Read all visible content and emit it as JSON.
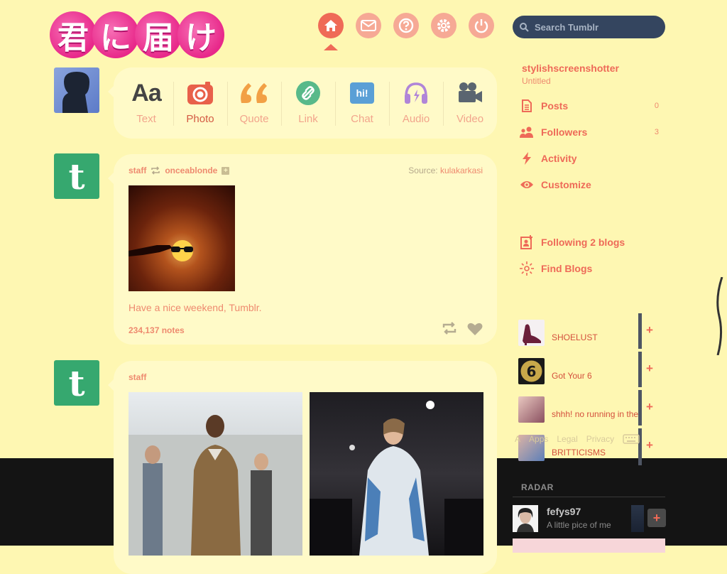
{
  "logo": {
    "chars": [
      "君",
      "に",
      "届",
      "け"
    ]
  },
  "nav": {
    "items": [
      {
        "name": "home",
        "active": true
      },
      {
        "name": "inbox"
      },
      {
        "name": "help"
      },
      {
        "name": "settings"
      },
      {
        "name": "logout"
      }
    ]
  },
  "search": {
    "placeholder": "Search Tumblr"
  },
  "post_types": [
    {
      "key": "text",
      "label": "Text",
      "icon": "Aa"
    },
    {
      "key": "photo",
      "label": "Photo"
    },
    {
      "key": "quote",
      "label": "Quote"
    },
    {
      "key": "link",
      "label": "Link"
    },
    {
      "key": "chat",
      "label": "Chat",
      "icon": "hi!"
    },
    {
      "key": "audio",
      "label": "Audio"
    },
    {
      "key": "video",
      "label": "Video"
    }
  ],
  "post1": {
    "author": "staff",
    "reblogged_from": "onceablonde",
    "source_label": "Source:",
    "source": "kulakarkasi",
    "caption": "Have a nice weekend, Tumblr.",
    "notes": "234,137 notes"
  },
  "post2": {
    "author": "staff"
  },
  "staff_avatar_glyph": "t",
  "sidebar": {
    "username": "stylishscreenshotter",
    "subtitle": "Untitled",
    "links": [
      {
        "label": "Posts",
        "count": "0",
        "icon": "posts-icon"
      },
      {
        "label": "Followers",
        "count": "3",
        "icon": "followers-icon"
      },
      {
        "label": "Activity",
        "count": "",
        "icon": "activity-icon"
      },
      {
        "label": "Customize",
        "count": "",
        "icon": "customize-icon"
      }
    ],
    "following": "Following 2 blogs",
    "find": "Find Blogs",
    "recommended": [
      {
        "title": "SHOELUST"
      },
      {
        "title": "Got Your 6"
      },
      {
        "title": "shhh! no running in the"
      },
      {
        "title": "BRITTICISMS"
      }
    ],
    "plus": "+",
    "footer": [
      "A",
      "Apps",
      "Legal",
      "Privacy"
    ]
  },
  "radar": {
    "heading": "RADAR",
    "name": "fefys97",
    "desc": "A little pice of me",
    "follow": "+"
  },
  "colors": {
    "background": "#fef7b2",
    "accent": "#ef6a57",
    "search_bg": "#34455f",
    "staff_green": "#36a86f"
  }
}
